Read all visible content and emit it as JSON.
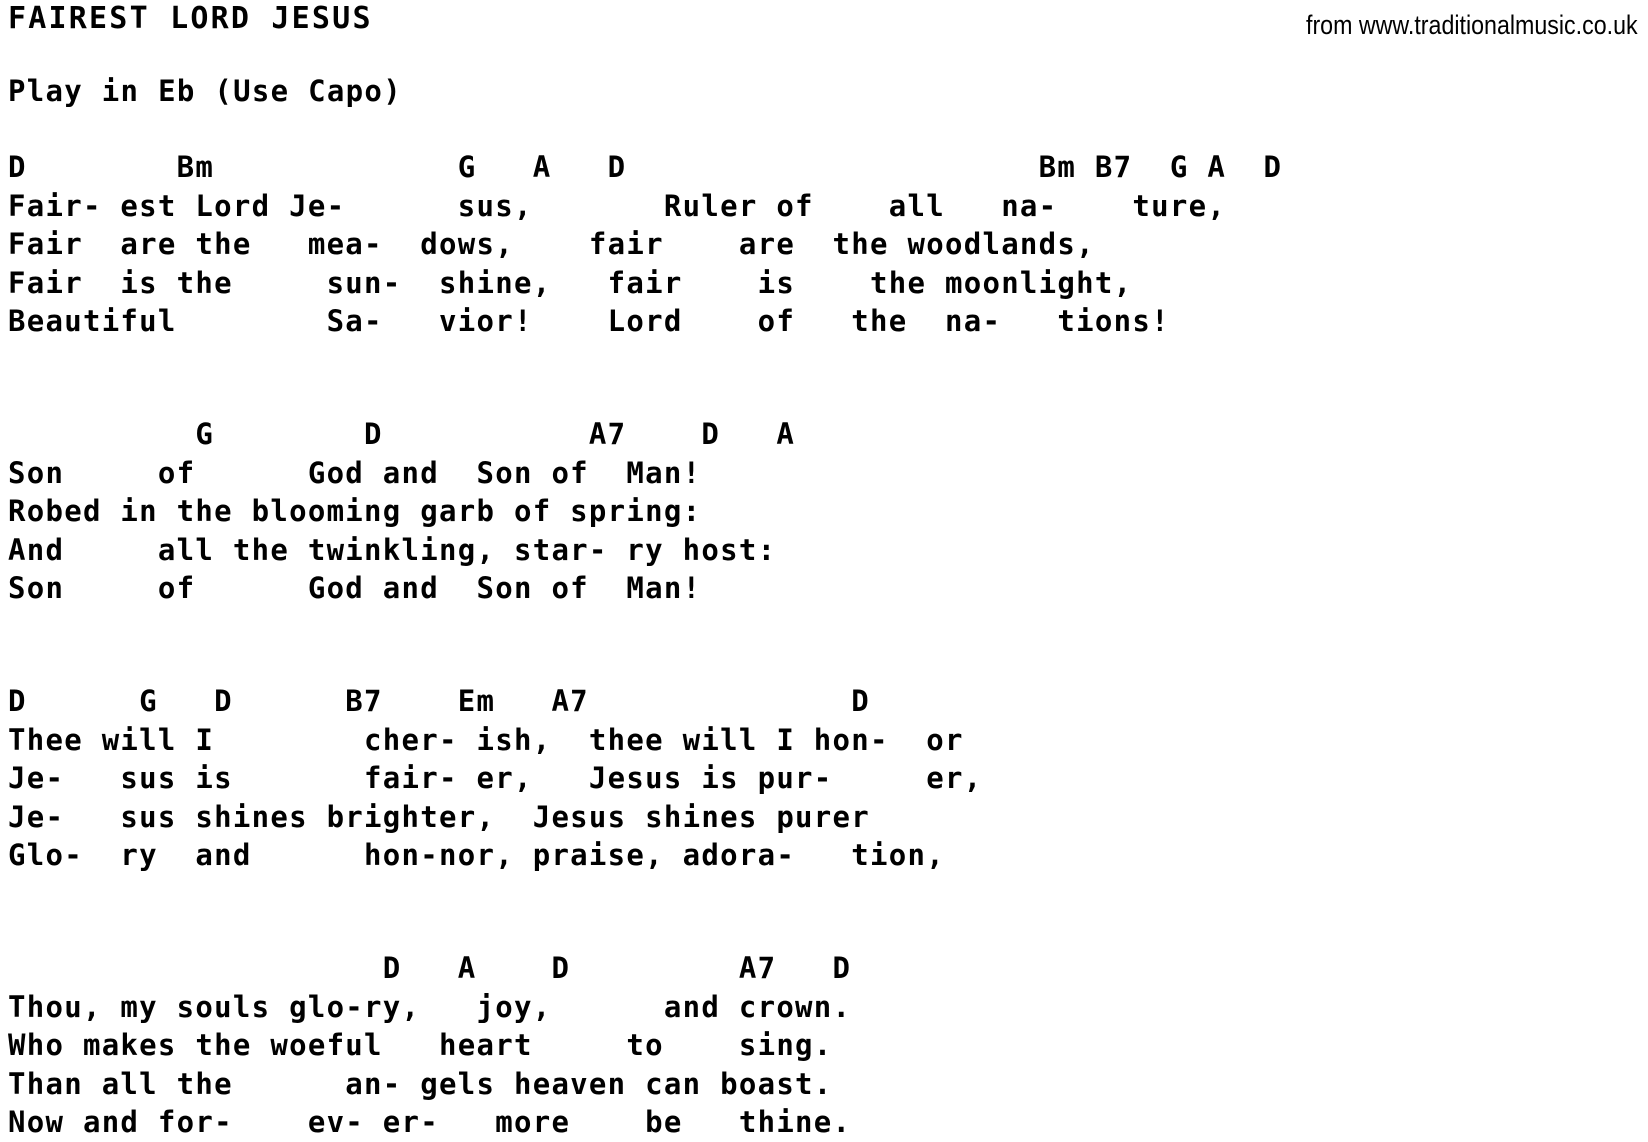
{
  "header": {
    "title": "FAIREST LORD JESUS",
    "source": "from www.traditionalmusic.co.uk"
  },
  "play_instruction": "Play in Eb (Use Capo)",
  "stanzas": [
    {
      "id": "stanza-1",
      "lines": [
        {
          "type": "chords",
          "text": "D        Bm             G   A   D                      Bm B7  G A  D"
        },
        {
          "type": "lyric",
          "text": "Fair- est Lord Je-      sus,       Ruler of    all   na-    ture,"
        },
        {
          "type": "lyric",
          "text": "Fair  are the   mea-  dows,    fair    are  the woodlands,"
        },
        {
          "type": "lyric",
          "text": "Fair  is the     sun-  shine,   fair    is    the moonlight,"
        },
        {
          "type": "lyric",
          "text": "Beautiful        Sa-   vior!    Lord    of   the  na-   tions!"
        }
      ]
    },
    {
      "id": "stanza-2",
      "lines": [
        {
          "type": "spacer",
          "text": ""
        },
        {
          "type": "chords",
          "text": "          G        D           A7    D   A"
        },
        {
          "type": "lyric",
          "text": "Son     of      God and  Son of  Man!"
        },
        {
          "type": "lyric",
          "text": "Robed in the blooming garb of spring:"
        },
        {
          "type": "lyric",
          "text": "And     all the twinkling, star- ry host:"
        },
        {
          "type": "lyric",
          "text": "Son     of      God and  Son of  Man!"
        }
      ]
    },
    {
      "id": "stanza-3",
      "lines": [
        {
          "type": "spacer",
          "text": ""
        },
        {
          "type": "chords",
          "text": "D      G   D      B7    Em   A7              D"
        },
        {
          "type": "lyric",
          "text": "Thee will I        cher- ish,  thee will I hon-  or"
        },
        {
          "type": "lyric",
          "text": "Je-   sus is       fair- er,   Jesus is pur-     er,"
        },
        {
          "type": "lyric",
          "text": "Je-   sus shines brighter,  Jesus shines purer"
        },
        {
          "type": "lyric",
          "text": "Glo-  ry  and      hon-nor, praise, adora-   tion,"
        }
      ]
    },
    {
      "id": "stanza-4",
      "lines": [
        {
          "type": "spacer",
          "text": ""
        },
        {
          "type": "chords",
          "text": "                    D   A    D         A7   D"
        },
        {
          "type": "lyric",
          "text": "Thou, my souls glo-ry,   joy,      and crown."
        },
        {
          "type": "lyric",
          "text": "Who makes the woeful   heart     to    sing."
        },
        {
          "type": "lyric",
          "text": "Than all the      an- gels heaven can boast."
        },
        {
          "type": "lyric",
          "text": "Now and for-    ev- er-   more    be   thine."
        }
      ]
    }
  ]
}
